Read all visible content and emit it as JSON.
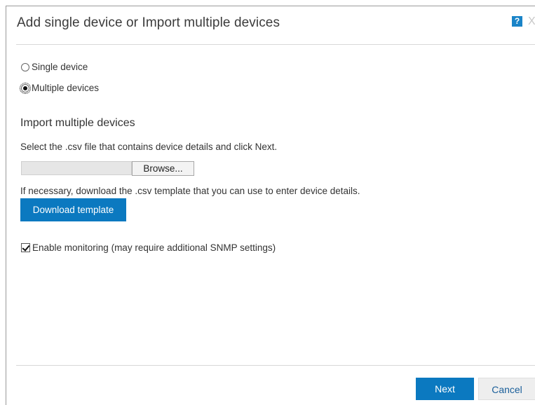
{
  "dialog": {
    "title": "Add single device or Import multiple devices",
    "help_icon_label": "?",
    "close_icon_label": "X"
  },
  "mode_options": [
    {
      "label": "Single device",
      "selected": false
    },
    {
      "label": "Multiple devices",
      "selected": true
    }
  ],
  "import_section": {
    "heading": "Import multiple devices",
    "select_instruction": "Select the .csv file that contains device details and click Next.",
    "file_value": "",
    "browse_label": "Browse...",
    "template_instruction": "If necessary, download the .csv template that you can use to enter device details.",
    "download_label": "Download template"
  },
  "monitoring": {
    "label": "Enable monitoring (may require additional SNMP settings)",
    "checked": true
  },
  "footer": {
    "next_label": "Next",
    "cancel_label": "Cancel"
  },
  "colors": {
    "primary": "#0b79c0",
    "help_icon": "#1a84c8",
    "cancel_text": "#1a5f9a"
  }
}
